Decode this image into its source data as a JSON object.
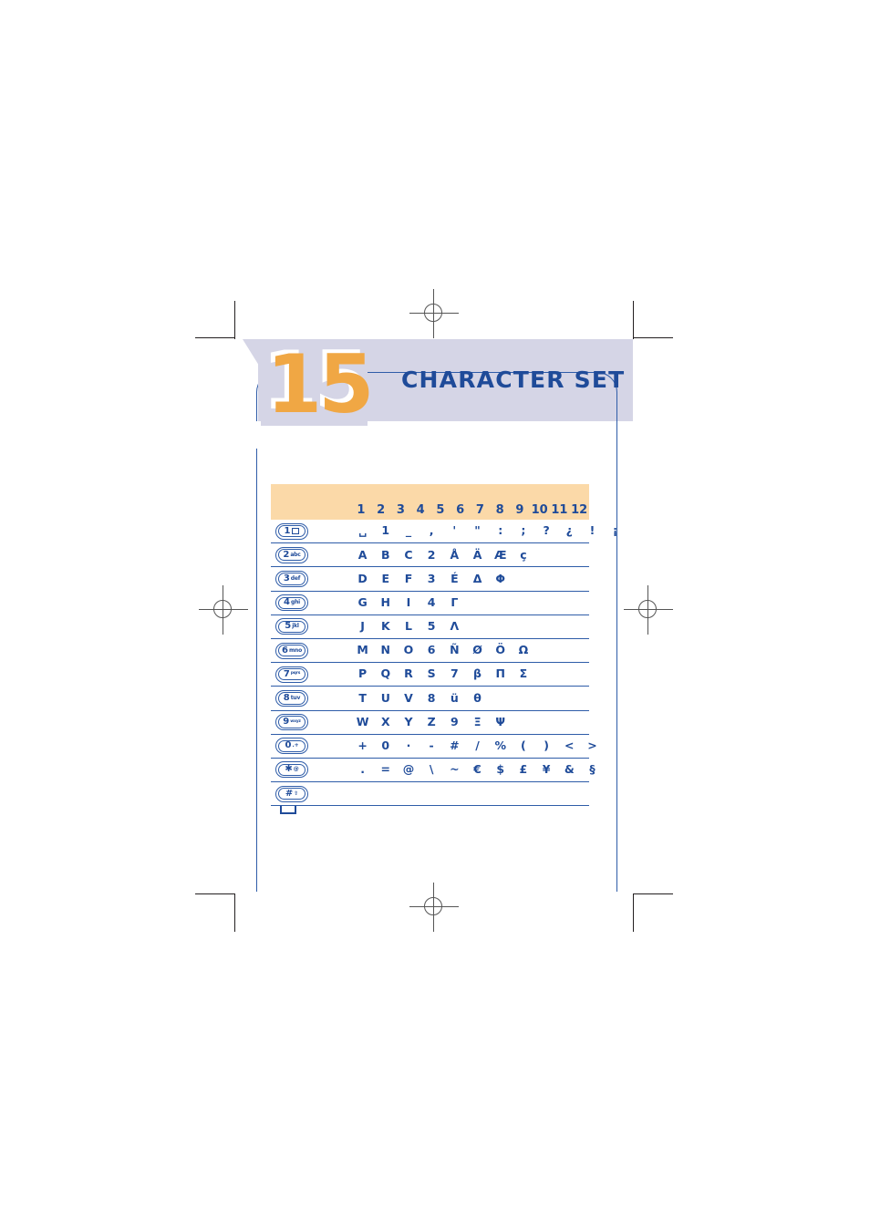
{
  "document": {
    "chapter_number": "15",
    "chapter_title": "CHARACTER SET"
  },
  "colors": {
    "banner_lavender": "#d5d5e6",
    "accent_orange": "#f0a744",
    "title_blue": "#1f4b99",
    "rule_blue": "#2e5ca8",
    "table_header_peach": "#fbd9a8"
  },
  "table": {
    "column_headers": [
      "1",
      "2",
      "3",
      "4",
      "5",
      "6",
      "7",
      "8",
      "9",
      "10",
      "11",
      "12"
    ],
    "rows": [
      {
        "key": {
          "name": "key-1",
          "main": "1",
          "sub": "",
          "icon": "message-box-icon"
        },
        "characters": [
          "␣",
          "1",
          "_",
          ",",
          "'",
          "\"",
          ":",
          ";",
          "?",
          "¿",
          "!",
          "¡"
        ]
      },
      {
        "key": {
          "name": "key-2",
          "main": "2",
          "sub": "abc",
          "icon": ""
        },
        "characters": [
          "A",
          "B",
          "C",
          "2",
          "Å",
          "Ä",
          "Æ",
          "ç"
        ]
      },
      {
        "key": {
          "name": "key-3",
          "main": "3",
          "sub": "def",
          "icon": ""
        },
        "characters": [
          "D",
          "E",
          "F",
          "3",
          "É",
          "Δ",
          "Φ"
        ]
      },
      {
        "key": {
          "name": "key-4",
          "main": "4",
          "sub": "ghi",
          "icon": ""
        },
        "characters": [
          "G",
          "H",
          "I",
          "4",
          "Γ"
        ]
      },
      {
        "key": {
          "name": "key-5",
          "main": "5",
          "sub": "jkl",
          "icon": ""
        },
        "characters": [
          "J",
          "K",
          "L",
          "5",
          "Λ"
        ]
      },
      {
        "key": {
          "name": "key-6",
          "main": "6",
          "sub": "mno",
          "icon": ""
        },
        "characters": [
          "M",
          "N",
          "O",
          "6",
          "Ñ",
          "Ø",
          "Ö",
          "Ω"
        ]
      },
      {
        "key": {
          "name": "key-7",
          "main": "7",
          "sub": "pqrs",
          "icon": ""
        },
        "characters": [
          "P",
          "Q",
          "R",
          "S",
          "7",
          "β",
          "Π",
          "Σ"
        ]
      },
      {
        "key": {
          "name": "key-8",
          "main": "8",
          "sub": "tuv",
          "icon": ""
        },
        "characters": [
          "T",
          "U",
          "V",
          "8",
          "ü",
          "θ"
        ]
      },
      {
        "key": {
          "name": "key-9",
          "main": "9",
          "sub": "wxyz",
          "icon": ""
        },
        "characters": [
          "W",
          "X",
          "Y",
          "Z",
          "9",
          "Ξ",
          "Ψ"
        ]
      },
      {
        "key": {
          "name": "key-0",
          "main": "0",
          "sub": ".+",
          "icon": ""
        },
        "characters": [
          "+",
          "0",
          "·",
          "-",
          "#",
          "/",
          "%",
          "(",
          ")",
          "<",
          ">"
        ]
      },
      {
        "key": {
          "name": "key-star",
          "main": "✱",
          "sub": "@",
          "icon": ""
        },
        "characters": [
          ".",
          "=",
          "@",
          "\\",
          "~",
          "€",
          "$",
          "£",
          "¥",
          "&",
          "§"
        ]
      },
      {
        "key": {
          "name": "key-hash",
          "main": "#",
          "sub": "⇧",
          "icon": ""
        },
        "characters": []
      }
    ]
  }
}
